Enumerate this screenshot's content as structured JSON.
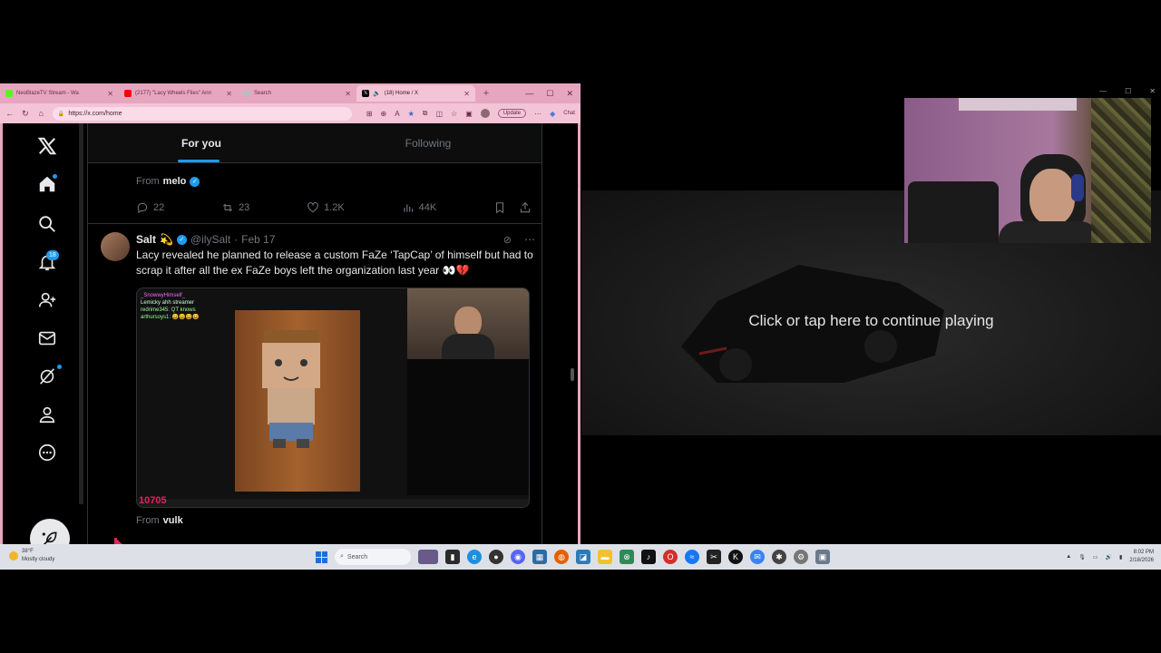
{
  "browser": {
    "tabs": [
      {
        "label": "NeoBlazeTV Stream - Wa",
        "color": "#53fc18",
        "active": false
      },
      {
        "label": "(2177) \"Lacy Wheels Files\" Ann",
        "color": "#ff0000",
        "active": false
      },
      {
        "label": "Search",
        "color": "#aaaaaa",
        "active": false
      },
      {
        "label": "(18) Home / X",
        "color": "#000000",
        "active": true
      }
    ],
    "url": "https://x.com/home",
    "update_label": "Update",
    "chat_label": "Chat"
  },
  "x": {
    "notification_count": "18",
    "feed_tabs": {
      "for_you": "For you",
      "following": "Following"
    },
    "prev_tweet": {
      "from_prefix": "From",
      "from_name": "melo",
      "replies": "22",
      "reposts": "23",
      "likes": "1.2K",
      "views": "44K"
    },
    "tweet": {
      "name": "Salt",
      "handle": "@ilySalt",
      "date": "Feb 17",
      "text": "Lacy revealed he planned to release a custom FaZe ‘TapCap’ of himself but had to scrap it after all the ex FaZe boys left the organization last year 👀💔",
      "media_chat": {
        "line1": "_SnowwyHimself_",
        "line2": "Lemicky ahh streamer",
        "line3": "redrime345: QT knows",
        "line4": "arthursoys1: 😀😀😀😀"
      },
      "media_counter": "10705",
      "from_prefix": "From",
      "from_name": "vulk"
    }
  },
  "player": {
    "continue_text": "Click or tap here to continue playing"
  },
  "taskbar": {
    "weather_temp": "38°F",
    "weather_desc": "Mostly cloudy",
    "search_placeholder": "Search",
    "time": "8:02 PM",
    "date": "2/18/2026"
  }
}
